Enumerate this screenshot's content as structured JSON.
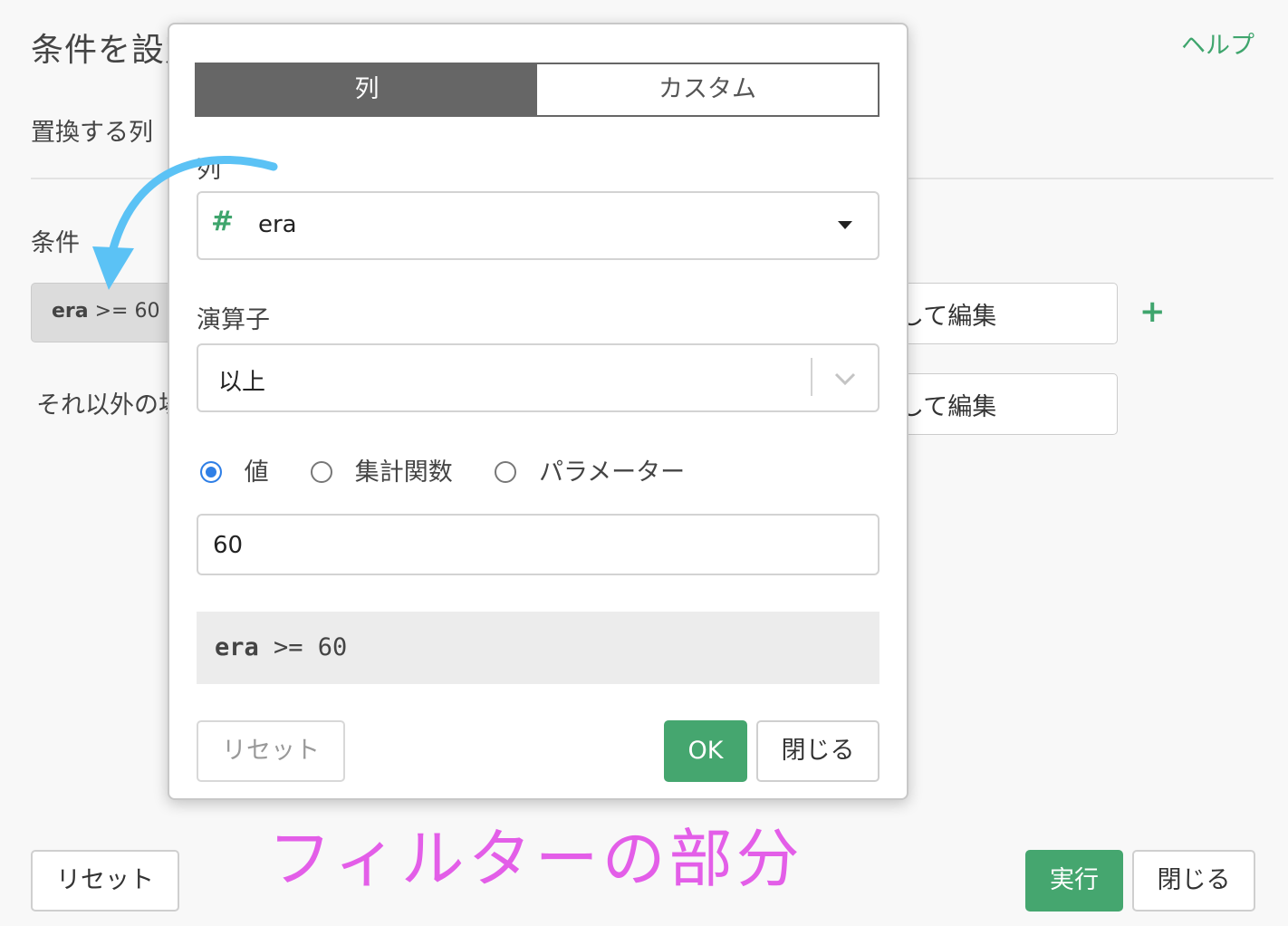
{
  "background_dialog": {
    "title": "条件を設定",
    "help_label": "ヘルプ",
    "replace_column_label": "置換する列",
    "condition_label": "条件",
    "condition_chip_column": "era",
    "condition_chip_rest": " >= 60",
    "edit_button_label": "して編集",
    "else_label": "それ以外の場合",
    "plus_label": "+",
    "reset_label": "リセット",
    "run_label": "実行",
    "close_label": "閉じる"
  },
  "popover": {
    "tabs": [
      {
        "label": "列",
        "active": true
      },
      {
        "label": "カスタム",
        "active": false
      }
    ],
    "column_label": "列",
    "column_select": {
      "type_icon": "#",
      "value": "era"
    },
    "operator_label": "演算子",
    "operator_select": {
      "value": "以上"
    },
    "value_types": [
      {
        "label": "値",
        "selected": true
      },
      {
        "label": "集計関数",
        "selected": false
      },
      {
        "label": "パラメーター",
        "selected": false
      }
    ],
    "value_input": "60",
    "preview": {
      "column": "era",
      "rest": " >= 60"
    },
    "reset_label": "リセット",
    "ok_label": "OK",
    "close_label": "閉じる"
  },
  "annotation": {
    "text": "フィルターの部分",
    "color": "#e35ee8"
  },
  "colors": {
    "accent_green": "#45a66f",
    "radio_blue": "#2f7fe6",
    "arrow_blue": "#5bc2f5"
  }
}
